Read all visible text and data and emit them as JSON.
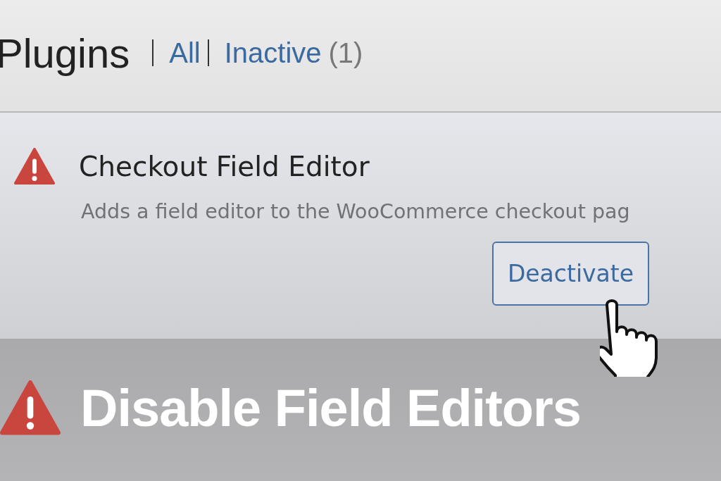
{
  "header": {
    "title": "Plugins",
    "filters": [
      {
        "label": "All"
      },
      {
        "label": "Inactive",
        "count": "(1)"
      }
    ]
  },
  "plugin": {
    "name": "Checkout Field Editor",
    "description": "Adds a field editor to the WooCommerce checkout pag",
    "action": "Deactivate"
  },
  "banner": {
    "text": "Disable Field Editors"
  }
}
